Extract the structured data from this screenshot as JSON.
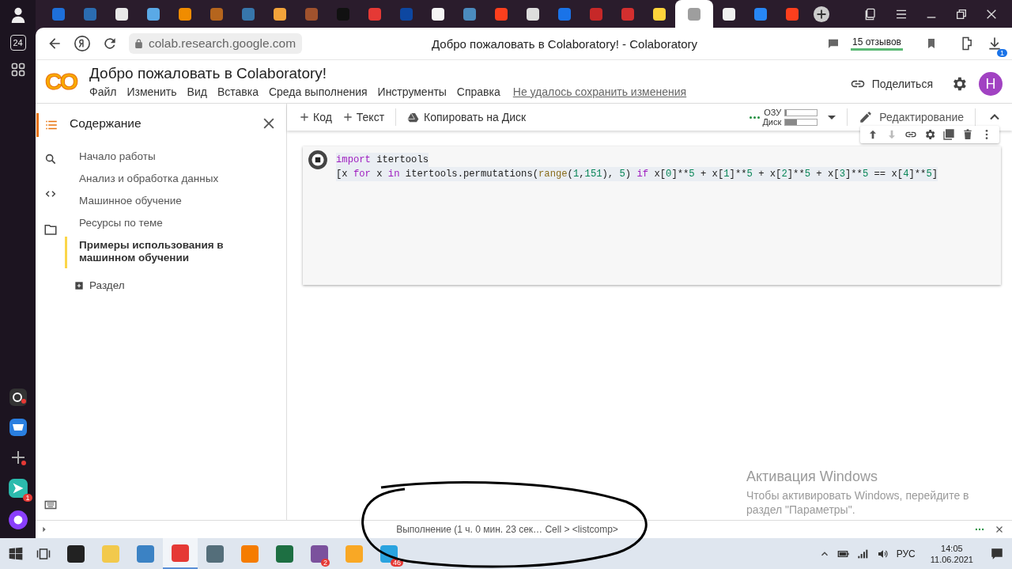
{
  "browser": {
    "tabs": [
      {
        "color": "#1e6fd9",
        "selected": false
      },
      {
        "color": "#2b6cb0",
        "selected": false
      },
      {
        "color": "#e8e8e8",
        "selected": false
      },
      {
        "color": "#5aa9e6",
        "selected": false
      },
      {
        "color": "#f08c00",
        "selected": false
      },
      {
        "color": "#b5651d",
        "selected": false
      },
      {
        "color": "#3776ab",
        "selected": false
      },
      {
        "color": "#f2a33a",
        "selected": false
      },
      {
        "color": "#a0522d",
        "selected": false
      },
      {
        "color": "#111111",
        "selected": false
      },
      {
        "color": "#e53935",
        "selected": false
      },
      {
        "color": "#0d47a1",
        "selected": false
      },
      {
        "color": "#f5f5f5",
        "selected": false
      },
      {
        "color": "#4b8bbe",
        "selected": false
      },
      {
        "color": "#fc3f1d",
        "selected": false
      },
      {
        "color": "#dddddd",
        "selected": false
      },
      {
        "color": "#1a73e8",
        "selected": false
      },
      {
        "color": "#c62828",
        "selected": false
      },
      {
        "color": "#d32f2f",
        "selected": false
      },
      {
        "color": "#ffd43b",
        "selected": false
      },
      {
        "color": "#9e9e9e",
        "selected": true
      },
      {
        "color": "#f0f0f0",
        "selected": false
      },
      {
        "color": "#2787f5",
        "selected": false
      },
      {
        "color": "#fc3f1d",
        "selected": false
      }
    ]
  },
  "address_bar": {
    "url": "colab.research.google.com",
    "page_title": "Добро пожаловать в Colaboratory! - Colaboratory",
    "reviews": "15 отзывов",
    "downloads_badge": "1"
  },
  "rail": {
    "counter": "24",
    "notification_badge": "1"
  },
  "colab": {
    "logo": "CO",
    "title": "Добро пожаловать в Colaboratory!",
    "menu": [
      "Файл",
      "Изменить",
      "Вид",
      "Вставка",
      "Среда выполнения",
      "Инструменты",
      "Справка"
    ],
    "unsaved_notice": "Не удалось сохранить изменения",
    "share": "Поделиться",
    "avatar": "Н",
    "toc": {
      "title": "Содержание",
      "items": [
        {
          "label": "Начало работы",
          "selected": false
        },
        {
          "label": "Анализ и обработка данных",
          "selected": false
        },
        {
          "label": "Машинное обучение",
          "selected": false
        },
        {
          "label": "Ресурсы по теме",
          "selected": false
        },
        {
          "label": "Примеры использования в машинном обучении",
          "selected": true
        }
      ],
      "add_section": "Раздел"
    },
    "toolbar": {
      "add_code": "Код",
      "add_text": "Текст",
      "copy_to_drive": "Копировать на Диск",
      "resources": [
        {
          "label": "ОЗУ",
          "level": 0.05
        },
        {
          "label": "Диск",
          "level": 0.36
        }
      ],
      "mode": "Редактирование"
    },
    "cell": {
      "running": true,
      "lines": [
        [
          {
            "kind": "keyword",
            "text": "import"
          },
          {
            "kind": "plain",
            "text": " itertools"
          }
        ],
        [
          {
            "kind": "plain",
            "text": "[x "
          },
          {
            "kind": "keyword",
            "text": "for"
          },
          {
            "kind": "plain",
            "text": " x "
          },
          {
            "kind": "keyword",
            "text": "in"
          },
          {
            "kind": "plain",
            "text": " itertools.permutations("
          },
          {
            "kind": "builtin",
            "text": "range"
          },
          {
            "kind": "plain",
            "text": "("
          },
          {
            "kind": "number",
            "text": "1"
          },
          {
            "kind": "plain",
            "text": ","
          },
          {
            "kind": "number",
            "text": "151"
          },
          {
            "kind": "plain",
            "text": "), "
          },
          {
            "kind": "number",
            "text": "5"
          },
          {
            "kind": "plain",
            "text": ") "
          },
          {
            "kind": "keyword",
            "text": "if"
          },
          {
            "kind": "plain",
            "text": " x["
          },
          {
            "kind": "number",
            "text": "0"
          },
          {
            "kind": "plain",
            "text": "]**"
          },
          {
            "kind": "number",
            "text": "5"
          },
          {
            "kind": "plain",
            "text": " + x["
          },
          {
            "kind": "number",
            "text": "1"
          },
          {
            "kind": "plain",
            "text": "]**"
          },
          {
            "kind": "number",
            "text": "5"
          },
          {
            "kind": "plain",
            "text": " + x["
          },
          {
            "kind": "number",
            "text": "2"
          },
          {
            "kind": "plain",
            "text": "]**"
          },
          {
            "kind": "number",
            "text": "5"
          },
          {
            "kind": "plain",
            "text": " + x["
          },
          {
            "kind": "number",
            "text": "3"
          },
          {
            "kind": "plain",
            "text": "]**"
          },
          {
            "kind": "number",
            "text": "5"
          },
          {
            "kind": "plain",
            "text": " == x["
          },
          {
            "kind": "number",
            "text": "4"
          },
          {
            "kind": "plain",
            "text": "]**"
          },
          {
            "kind": "number",
            "text": "5"
          },
          {
            "kind": "plain",
            "text": "]"
          }
        ]
      ]
    },
    "status_bar": {
      "text": "Выполнение (1 ч. 0 мин. 23 сек… Cell > <listcomp>"
    }
  },
  "windows_activation": {
    "title": "Активация Windows",
    "text": "Чтобы активировать Windows, перейдите в раздел \"Параметры\"."
  },
  "ink_annotation": {
    "kind": "ellipse"
  },
  "taskbar": {
    "apps": [
      {
        "color": "#222222",
        "selected": false
      },
      {
        "color": "#f2c94c",
        "selected": false
      },
      {
        "color": "#3b82c4",
        "selected": false
      },
      {
        "color": "#e53935",
        "selected": true
      },
      {
        "color": "#546e7a",
        "selected": false
      },
      {
        "color": "#f57c00",
        "selected": false
      },
      {
        "color": "#1d6f42",
        "selected": false
      },
      {
        "color": "#7b519d",
        "badge": "2",
        "selected": false
      },
      {
        "color": "#f9a825",
        "selected": false
      },
      {
        "color": "#2aa3df",
        "badge": "46",
        "selected": false
      }
    ],
    "language": "РУС",
    "time": "14:05",
    "date": "11.06.2021"
  }
}
